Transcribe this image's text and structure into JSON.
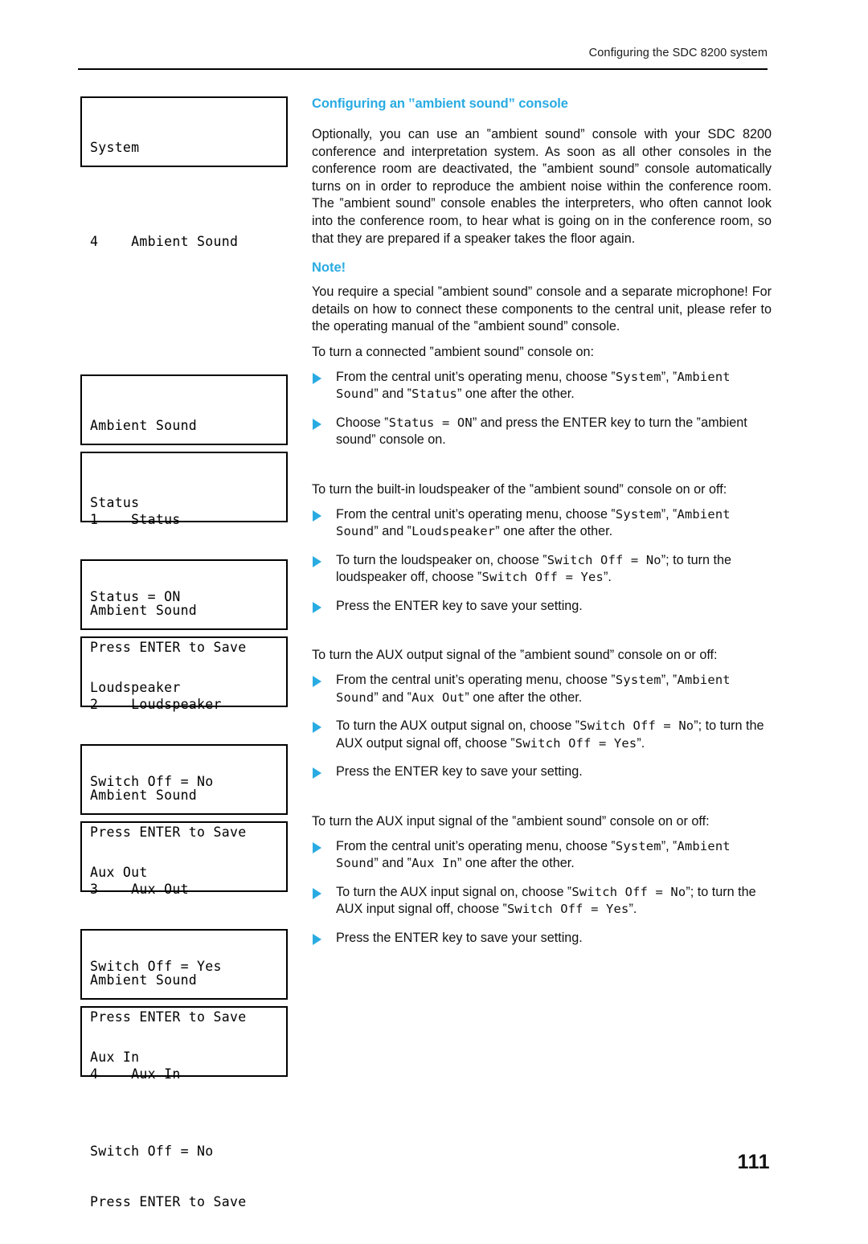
{
  "header": {
    "running_title": "Configuring the SDC 8200 system"
  },
  "page": {
    "number": "111"
  },
  "section": {
    "title": "Configuring an ‟ambient sound” console",
    "intro": "Optionally, you can use an ‟ambient sound” console with your SDC 8200 conference and interpretation system. As soon as all other consoles in the conference room are deactivated, the ‟ambient sound” console automatically turns on in order to reproduce the ambient noise within the conference room. The ‟ambient sound” console enables the interpreters, who often cannot look into the conference room, to hear what is going on in the conference room, so that they are prepared if a speaker takes the floor again."
  },
  "note": {
    "label": "Note!",
    "text": "You require a special ‟ambient sound” console and a separate microphone! For details on how to connect these components to the central unit, please refer to the operating manual of the ‟ambient sound” console."
  },
  "procedures": {
    "status": {
      "lead_in": "To turn a connected ‟ambient sound” console on:",
      "step1_a": "From the central unit’s operating menu, choose ‟",
      "step1_m1": "System",
      "step1_b": "”, ‟",
      "step1_m2": "Ambient Sound",
      "step1_c": "” and ‟",
      "step1_m3": "Status",
      "step1_d": "” one after the other.",
      "step2_a": "Choose ‟",
      "step2_m1": "Status = ON",
      "step2_b": "” and press the ENTER key to turn the ‟ambient sound” console on."
    },
    "loudspeaker": {
      "lead_in": "To turn the built-in loudspeaker of the ‟ambient sound” console on or off:",
      "step1_a": "From the central unit’s operating menu, choose ‟",
      "step1_m1": "System",
      "step1_b": "”, ‟",
      "step1_m2": "Ambient Sound",
      "step1_c": "” and ‟",
      "step1_m3": "Loudspeaker",
      "step1_d": "” one after the other.",
      "step2_a": "To turn the loudspeaker on, choose ‟",
      "step2_m1": "Switch Off = No",
      "step2_b": "”; to turn the loudspeaker off, choose ‟",
      "step2_m2": "Switch Off = Yes",
      "step2_c": "”.",
      "step3": "Press the ENTER key to save your setting."
    },
    "aux_out": {
      "lead_in": "To turn the AUX output signal of the ‟ambient sound” console on or off:",
      "step1_a": "From the central unit’s operating menu, choose ‟",
      "step1_m1": "System",
      "step1_b": "”, ‟",
      "step1_m2": "Ambient Sound",
      "step1_c": "” and ‟",
      "step1_m3": "Aux Out",
      "step1_d": "” one after the other.",
      "step2_a": "To turn the AUX output signal on, choose ‟",
      "step2_m1": "Switch Off = No",
      "step2_b": "”; to turn the AUX output signal off, choose ‟",
      "step2_m2": "Switch Off = Yes",
      "step2_c": "”.",
      "step3": "Press the ENTER key to save your setting."
    },
    "aux_in": {
      "lead_in": "To turn the AUX input signal of the ‟ambient sound” console on or off:",
      "step1_a": "From the central unit’s operating menu, choose ‟",
      "step1_m1": "System",
      "step1_b": "”, ‟",
      "step1_m2": "Ambient Sound",
      "step1_c": "” and ‟",
      "step1_m3": "Aux In",
      "step1_d": "” one after the other.",
      "step2_a": "To turn the AUX input signal on, choose ‟",
      "step2_m1": "Switch Off = No",
      "step2_b": "”; to turn the AUX input signal off, choose ‟",
      "step2_m2": "Switch Off = Yes",
      "step2_c": "”.",
      "step3": "Press the ENTER key to save your setting."
    }
  },
  "lcd_screens": {
    "system_menu": {
      "line1": "System",
      "line2": "4    Ambient Sound"
    },
    "ambient_status_menu": {
      "line1": "Ambient Sound",
      "line2": "1    Status"
    },
    "status_setting": {
      "line1": "Status",
      "line2": "Status = ON",
      "line3": "Press ENTER to Save"
    },
    "ambient_loudspeaker_menu": {
      "line1": "Ambient Sound",
      "line2": "2    Loudspeaker"
    },
    "loudspeaker_setting": {
      "line1": "Loudspeaker",
      "line2": "Switch Off = No",
      "line3": "Press ENTER to Save"
    },
    "ambient_auxout_menu": {
      "line1": "Ambient Sound",
      "line2": "3    Aux Out"
    },
    "auxout_setting": {
      "line1": "Aux Out",
      "line2": "Switch Off = Yes",
      "line3": "Press ENTER to Save"
    },
    "ambient_auxin_menu": {
      "line1": "Ambient Sound",
      "line2": "4    Aux In"
    },
    "auxin_setting": {
      "line1": "Aux In",
      "line2": "Switch Off = No",
      "line3": "Press ENTER to Save"
    }
  },
  "colors": {
    "accent": "#29ABE2",
    "text": "#111111",
    "rule": "#000000"
  }
}
